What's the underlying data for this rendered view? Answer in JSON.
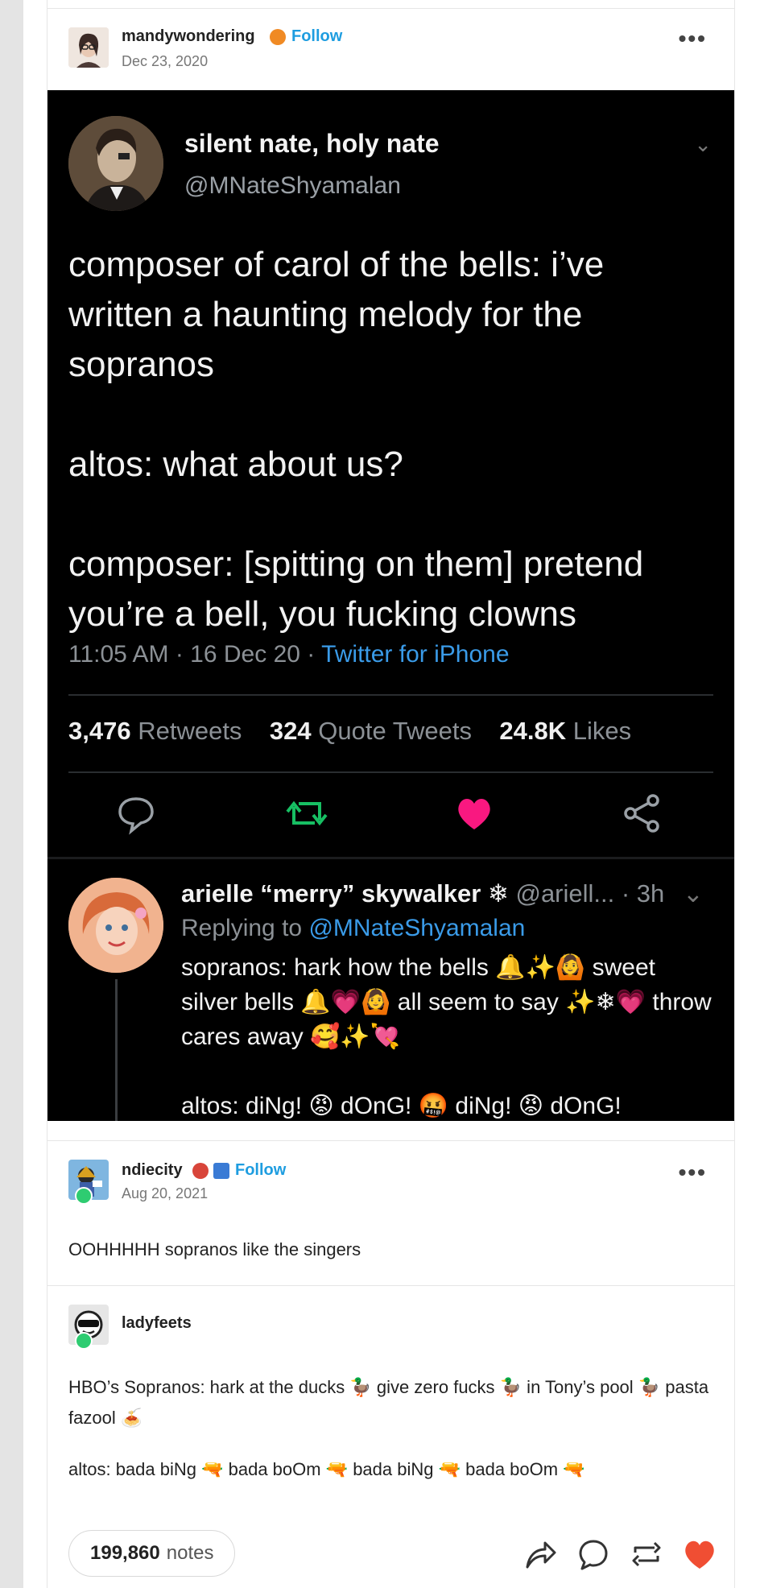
{
  "post": {
    "username": "mandywondering",
    "follow_label": "Follow",
    "date": "Dec 23, 2020",
    "more_label": "•••"
  },
  "tweet": {
    "display_name": "silent nate, holy nate",
    "handle": "@MNateShyamalan",
    "body": "composer of carol of the bells: i’ve written a haunting melody for the sopranos\n\naltos: what about us?\n\ncomposer: [spitting on them] pretend you’re a bell, you fucking clowns",
    "time": "11:05 AM · 16 Dec 20 · ",
    "source": "Twitter for iPhone",
    "retweets_count": "3,476",
    "retweets_label": "Retweets",
    "quotes_count": "324",
    "quotes_label": "Quote Tweets",
    "likes_count": "24.8K",
    "likes_label": "Likes"
  },
  "reply": {
    "display_name": "arielle “merry” skywalker ❄",
    "handle_time": " @ariell... · 3h",
    "replying_prefix": "Replying to ",
    "replying_to": "@MNateShyamalan",
    "body": "sopranos: hark how the bells 🔔✨🙆 sweet silver bells 🔔💗🙆 all seem to say ✨❄💗 throw cares away 🥰✨💘\n\naltos: diNg! 😡 dOnG! 🤬 diNg! 😡 dOnG!"
  },
  "reblog1": {
    "username": "ndiecity",
    "follow_label": "Follow",
    "date": "Aug 20, 2021",
    "more_label": "•••",
    "text": "OOHHHHH sopranos like the singers"
  },
  "reblog2": {
    "username": "ladyfeets",
    "text1": "HBO’s Sopranos: hark at the ducks 🦆 give zero fucks 🦆 in Tony’s pool 🦆 pasta fazool 🍝",
    "text2": "altos: bada biNg 🔫 bada boOm 🔫 bada biNg 🔫 bada boOm 🔫"
  },
  "footer": {
    "notes_count": "199,860",
    "notes_label": "notes"
  },
  "colors": {
    "accent_blue": "#1e9de0",
    "twitter_blue": "#3a9be8",
    "like_red": "#f04e33",
    "retweet_green": "#17bf63"
  }
}
